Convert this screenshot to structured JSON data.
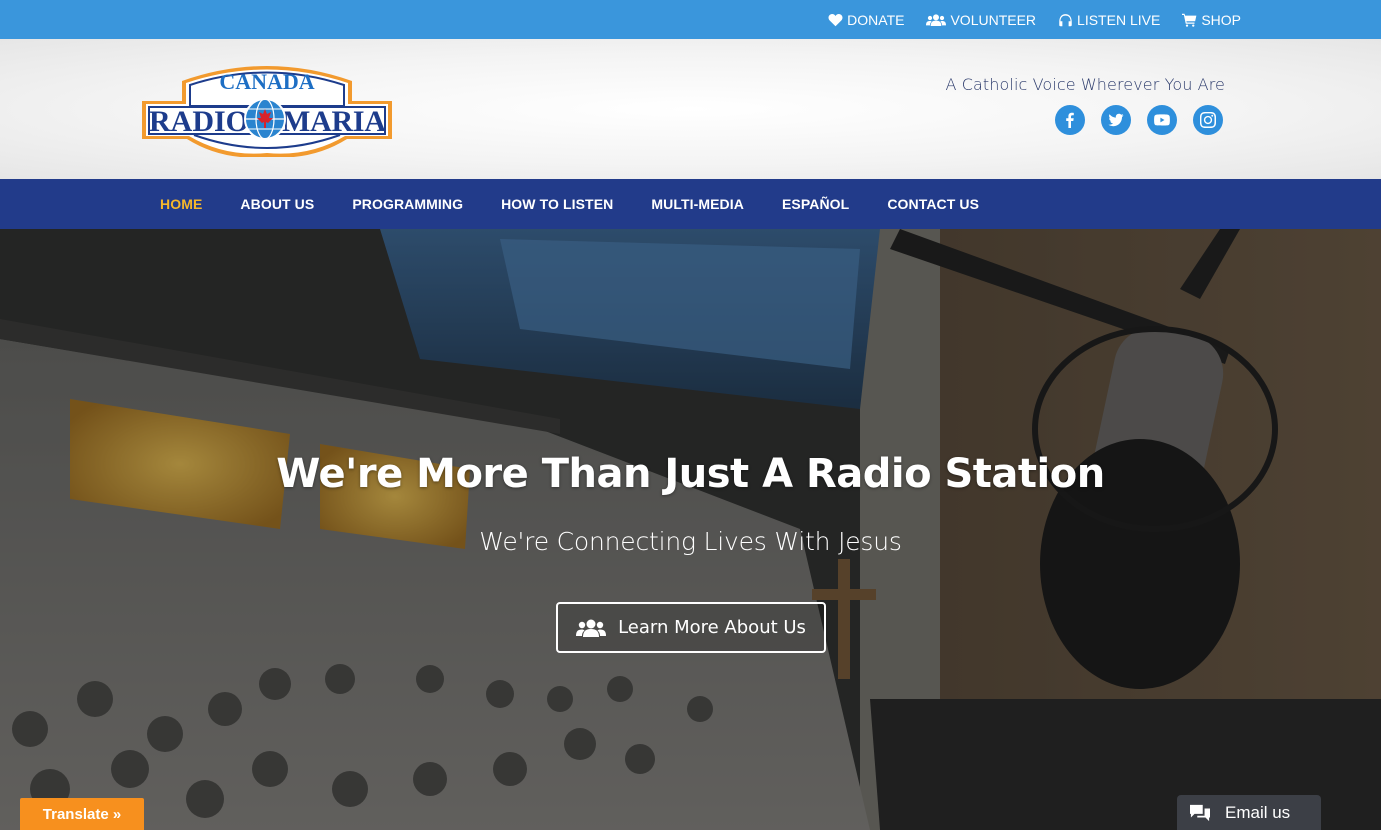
{
  "topbar": {
    "links": [
      {
        "label": "DONATE",
        "icon": "heart-icon"
      },
      {
        "label": "VOLUNTEER",
        "icon": "users-icon"
      },
      {
        "label": "LISTEN LIVE",
        "icon": "headphones-icon"
      },
      {
        "label": "SHOP",
        "icon": "cart-icon"
      }
    ]
  },
  "header": {
    "logo": {
      "line1": "CANADA",
      "line2a": "RADIO",
      "line2b": "MARIA"
    },
    "tagline": "A Catholic Voice Wherever You Are",
    "socials": [
      "facebook-icon",
      "twitter-icon",
      "youtube-icon",
      "instagram-icon"
    ]
  },
  "nav": {
    "items": [
      "HOME",
      "ABOUT US",
      "PROGRAMMING",
      "HOW TO LISTEN",
      "MULTI-MEDIA",
      "ESPAÑOL",
      "CONTACT US"
    ],
    "active": "HOME"
  },
  "hero": {
    "title": "We're More Than Just A Radio Station",
    "subtitle": "We're Connecting Lives With Jesus",
    "button_label": "Learn More About Us"
  },
  "widgets": {
    "translate_label": "Translate »",
    "email_label": "Email us"
  },
  "colors": {
    "topbar": "#3a96dc",
    "nav": "#223b8a",
    "nav_active": "#f6b72b",
    "social": "#2e8fdc",
    "translate": "#f7901e"
  }
}
